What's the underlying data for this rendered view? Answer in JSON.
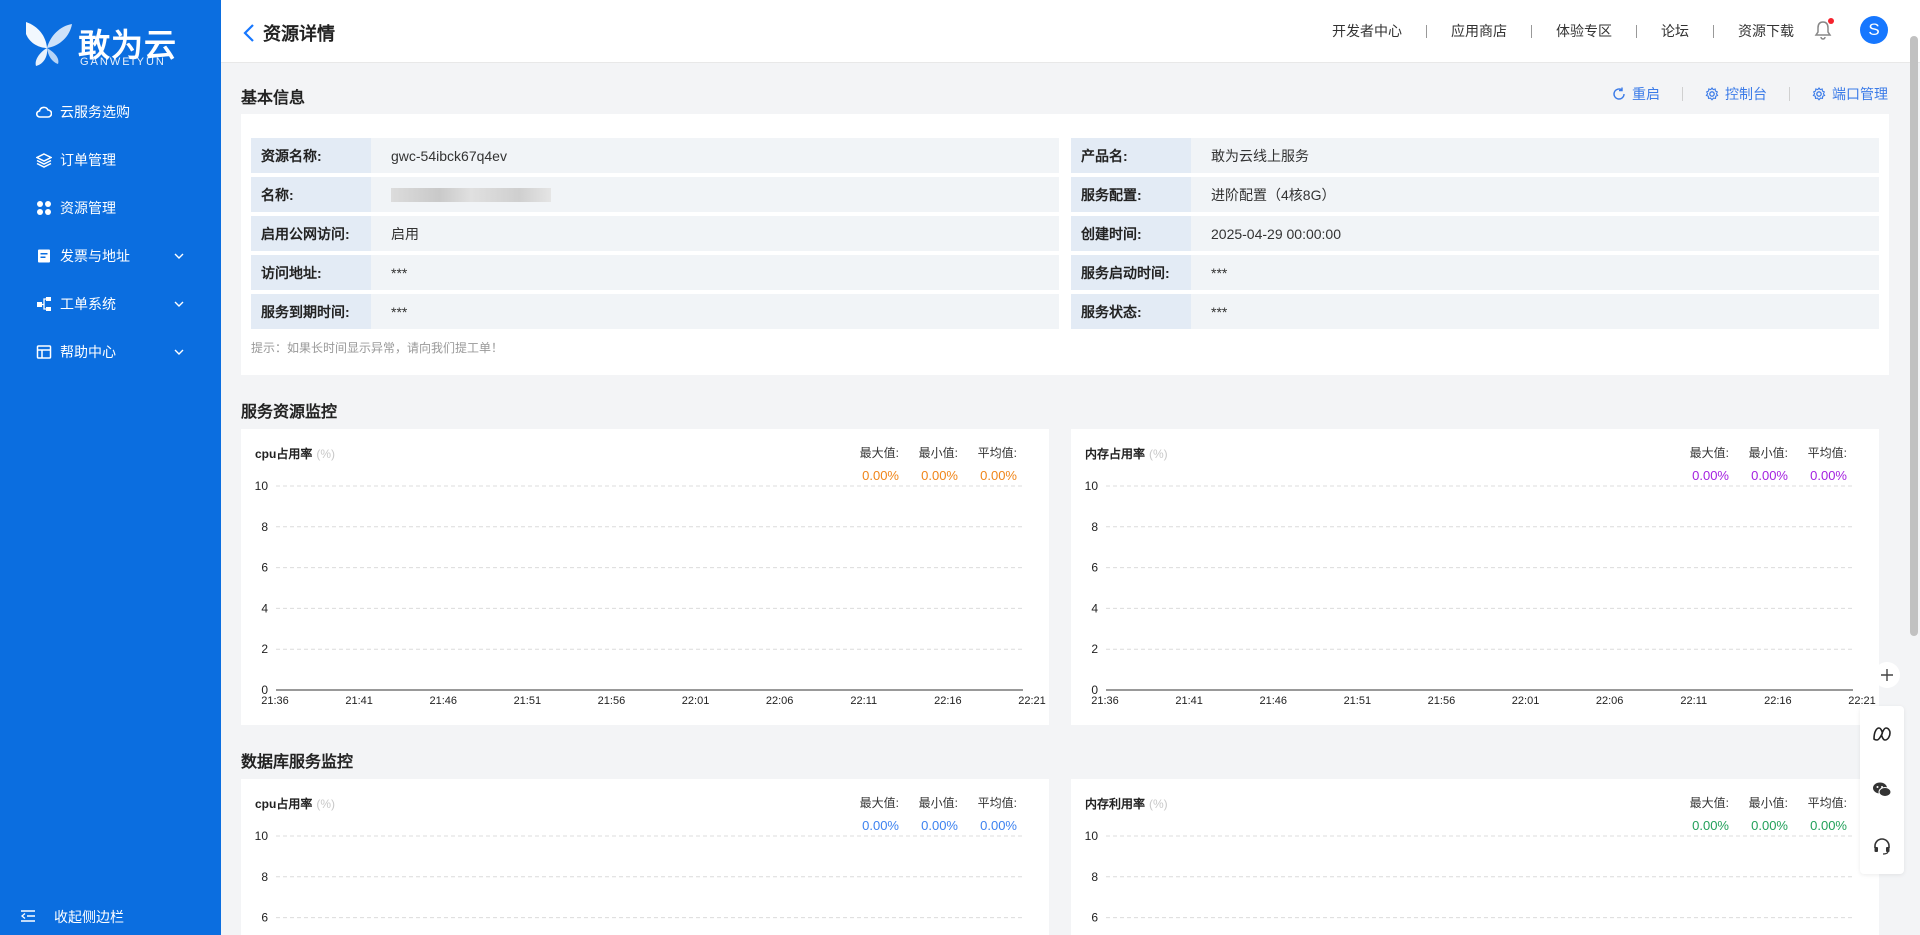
{
  "brand": {
    "name": "敢为云",
    "sub": "GANWEIYUN"
  },
  "sidebar": {
    "items": [
      {
        "label": "云服务选购",
        "icon": "cloud-icon",
        "expandable": false
      },
      {
        "label": "订单管理",
        "icon": "layers-icon",
        "expandable": false
      },
      {
        "label": "资源管理",
        "icon": "grid-icon",
        "expandable": false
      },
      {
        "label": "发票与地址",
        "icon": "invoice-icon",
        "expandable": true
      },
      {
        "label": "工单系统",
        "icon": "workflow-icon",
        "expandable": true
      },
      {
        "label": "帮助中心",
        "icon": "help-icon",
        "expandable": true
      }
    ],
    "collapse_label": "收起侧边栏"
  },
  "header": {
    "title": "资源详情",
    "nav": [
      "开发者中心",
      "应用商店",
      "体验专区",
      "论坛",
      "资源下载"
    ],
    "avatar_letter": "S"
  },
  "basic_info": {
    "title": "基本信息",
    "actions": [
      "重启",
      "控制台",
      "端口管理"
    ],
    "left": [
      {
        "key": "资源名称:",
        "value": "gwc-54ibck67q4ev"
      },
      {
        "key": "名称:",
        "value": ""
      },
      {
        "key": "启用公网访问:",
        "value": "启用"
      },
      {
        "key": "访问地址:",
        "value": "***"
      },
      {
        "key": "服务到期时间:",
        "value": "***"
      }
    ],
    "right": [
      {
        "key": "产品名:",
        "value": "敢为云线上服务"
      },
      {
        "key": "服务配置:",
        "value": "进阶配置（4核8G）"
      },
      {
        "key": "创建时间:",
        "value": "2025-04-29 00:00:00"
      },
      {
        "key": "服务启动时间:",
        "value": "***"
      },
      {
        "key": "服务状态:",
        "value": "***"
      }
    ],
    "tip": "提示：如果长时间显示异常，请向我们提工单！"
  },
  "stat_labels": {
    "max": "最大值:",
    "min": "最小值:",
    "avg": "平均值:"
  },
  "sections": {
    "service": "服务资源监控",
    "database": "数据库服务监控"
  },
  "chart_data": [
    {
      "type": "line",
      "title": "cpu占用率",
      "unit": "(%)",
      "stats": {
        "max": "0.00%",
        "min": "0.00%",
        "avg": "0.00%"
      },
      "stat_color": "#f08519",
      "x": [
        "21:36",
        "21:41",
        "21:46",
        "21:51",
        "21:56",
        "22:01",
        "22:06",
        "22:11",
        "22:16",
        "22:21"
      ],
      "y": [
        0,
        0,
        0,
        0,
        0,
        0,
        0,
        0,
        0,
        0
      ],
      "yticks": [
        0,
        2,
        4,
        6,
        8,
        10
      ],
      "ylim": [
        0,
        10
      ],
      "grid": true
    },
    {
      "type": "line",
      "title": "内存占用率",
      "unit": "(%)",
      "stats": {
        "max": "0.00%",
        "min": "0.00%",
        "avg": "0.00%"
      },
      "stat_color": "#a421e0",
      "x": [
        "21:36",
        "21:41",
        "21:46",
        "21:51",
        "21:56",
        "22:01",
        "22:06",
        "22:11",
        "22:16",
        "22:21"
      ],
      "y": [
        0,
        0,
        0,
        0,
        0,
        0,
        0,
        0,
        0,
        0
      ],
      "yticks": [
        0,
        2,
        4,
        6,
        8,
        10
      ],
      "ylim": [
        0,
        10
      ],
      "grid": true
    },
    {
      "type": "line",
      "title": "cpu占用率",
      "unit": "(%)",
      "stats": {
        "max": "0.00%",
        "min": "0.00%",
        "avg": "0.00%"
      },
      "stat_color": "#3d82f0",
      "x": [],
      "y": [],
      "yticks": [
        6,
        8,
        10
      ],
      "ylim": [
        0,
        10
      ],
      "grid": true
    },
    {
      "type": "line",
      "title": "内存利用率",
      "unit": "(%)",
      "stats": {
        "max": "0.00%",
        "min": "0.00%",
        "avg": "0.00%"
      },
      "stat_color": "#22a05a",
      "x": [],
      "y": [],
      "yticks": [
        6,
        8,
        10
      ],
      "ylim": [
        0,
        10
      ],
      "grid": true
    }
  ]
}
